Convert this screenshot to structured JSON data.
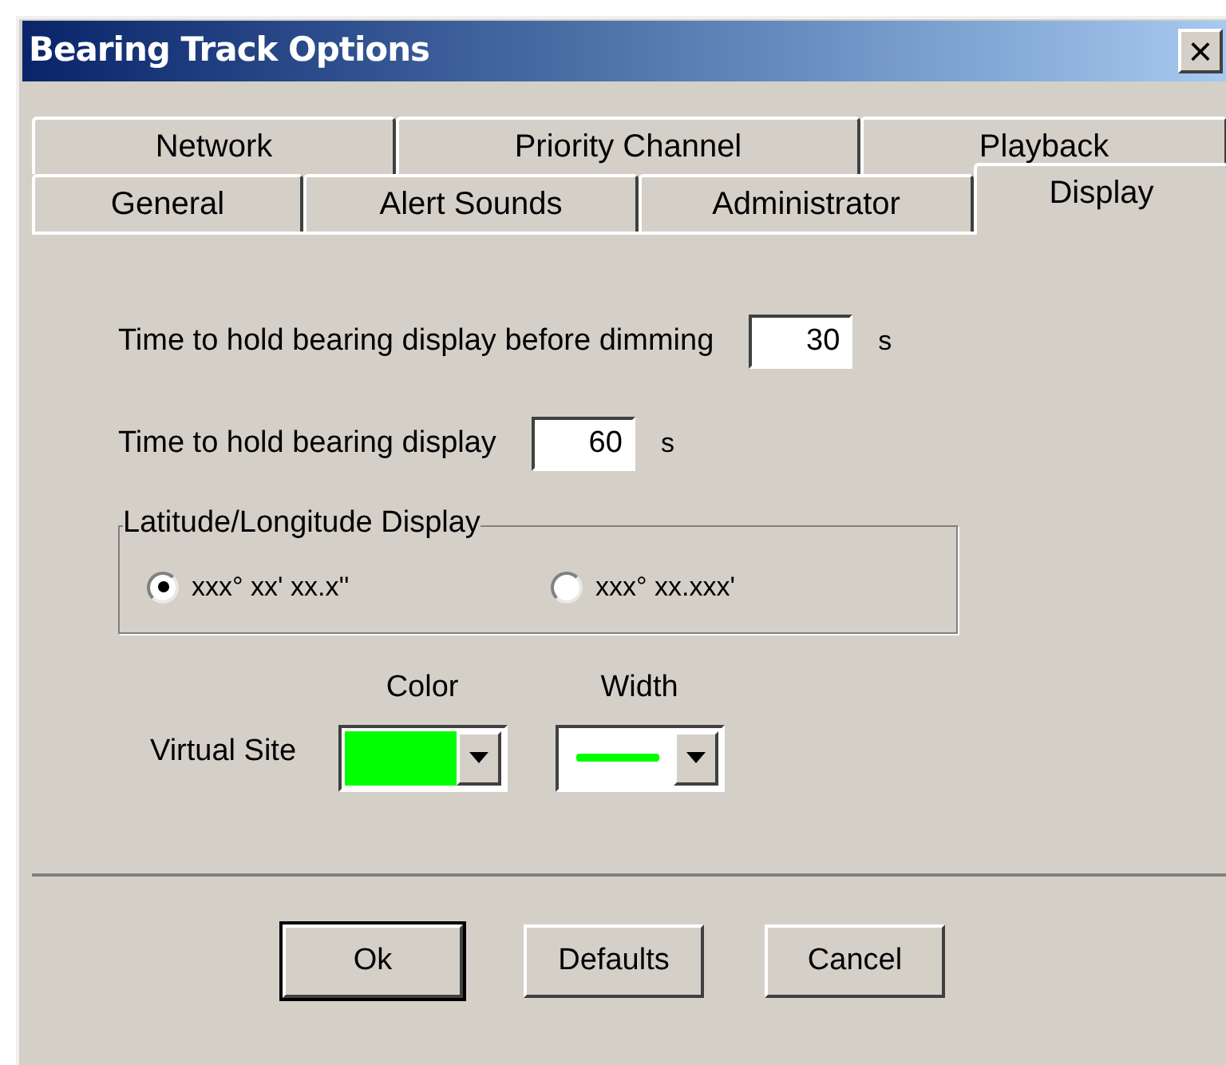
{
  "window": {
    "title": "Bearing Track Options",
    "close": "×"
  },
  "tab_rows": [
    [
      {
        "label": "Network",
        "selected": false
      },
      {
        "label": "Priority Channel",
        "selected": false
      },
      {
        "label": "Playback",
        "selected": false
      }
    ],
    [
      {
        "label": "General",
        "selected": false
      },
      {
        "label": "Alert Sounds",
        "selected": false
      },
      {
        "label": "Administrator",
        "selected": false
      },
      {
        "label": "Display",
        "selected": true
      }
    ]
  ],
  "fields": [
    {
      "label": "Time to hold bearing display before dimming",
      "value": "30",
      "unit": "s"
    },
    {
      "label": "Time to hold bearing display",
      "value": "60",
      "unit": "s"
    }
  ],
  "lat_lon_group": {
    "title": "Latitude/Longitude Display",
    "options": [
      {
        "label": "xxx° xx' xx.x''",
        "selected": true
      },
      {
        "label": "xxx° xx.xxx'",
        "selected": false
      }
    ]
  },
  "virtual_site": {
    "label": "Virtual Site",
    "color_heading": "Color",
    "width_heading": "Width",
    "color": "#00ff00"
  },
  "buttons": [
    {
      "label": "Ok",
      "default": true
    },
    {
      "label": "Defaults",
      "default": false
    },
    {
      "label": "Cancel",
      "default": false
    }
  ]
}
